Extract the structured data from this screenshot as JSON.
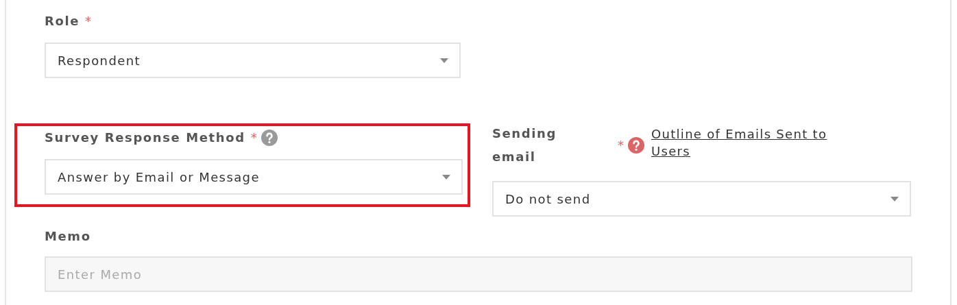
{
  "role": {
    "label": "Role",
    "required_mark": "*",
    "value": "Respondent"
  },
  "response_method": {
    "label": "Survey Response Method",
    "required_mark": "*",
    "help": {
      "color": "#9a9a9a"
    },
    "highlighted": true,
    "value": "Answer by Email or Message"
  },
  "sending_email": {
    "label": "Sending email",
    "required_mark": "*",
    "help": {
      "color": "#dc6464"
    },
    "link": "Outline of Emails Sent to Users",
    "value": "Do not send"
  },
  "memo": {
    "label": "Memo",
    "placeholder": "Enter Memo"
  }
}
